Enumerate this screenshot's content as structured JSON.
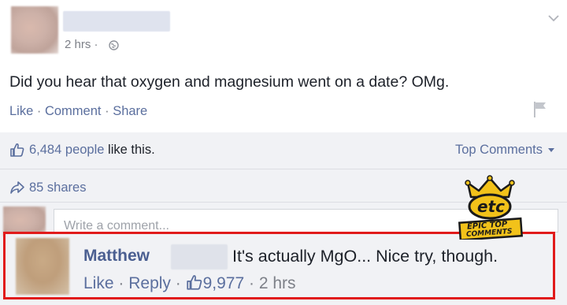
{
  "post": {
    "time": "2 hrs",
    "dot": "·",
    "text": "Did you hear that oxygen and magnesium went on a date? OMg.",
    "actions": {
      "like": "Like",
      "comment": "Comment",
      "share": "Share",
      "sep": "·"
    }
  },
  "stats": {
    "likes_count": "6,484",
    "likes_suffix": "people like this.",
    "sort_label": "Top Comments",
    "shares": "85 shares"
  },
  "comment_box": {
    "placeholder": "Write a comment..."
  },
  "comment": {
    "author": "Matthew",
    "text": "It's actually MgO... Nice try, though.",
    "like": "Like",
    "reply": "Reply",
    "likes_count": "9,977",
    "time": "2 hrs",
    "sep": "·"
  },
  "watermark": {
    "line1": "etc",
    "line2": "EPIC TOP",
    "line3": "COMMENTS"
  },
  "colors": {
    "highlight_border": "#e11b1b",
    "link": "#5b6f9e",
    "stats_bg": "#f1f2f5"
  }
}
